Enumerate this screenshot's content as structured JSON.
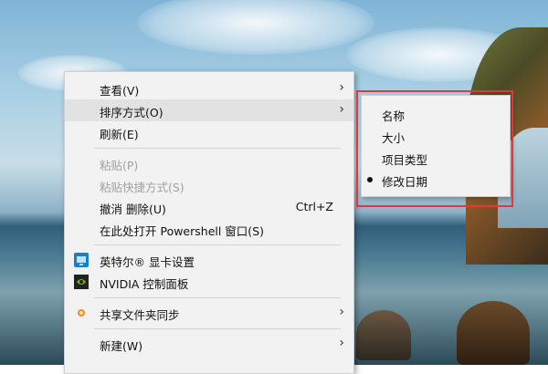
{
  "context_menu": {
    "items": [
      {
        "label": "查看(V)",
        "submenu": true,
        "enabled": true
      },
      {
        "label": "排序方式(O)",
        "submenu": true,
        "enabled": true,
        "highlighted": true
      },
      {
        "label": "刷新(E)",
        "submenu": false,
        "enabled": true
      },
      {
        "label": "粘贴(P)",
        "submenu": false,
        "enabled": false
      },
      {
        "label": "粘贴快捷方式(S)",
        "submenu": false,
        "enabled": false
      },
      {
        "label": "撤消 删除(U)",
        "shortcut": "Ctrl+Z",
        "submenu": false,
        "enabled": true
      },
      {
        "label": "在此处打开 Powershell 窗口(S)",
        "submenu": false,
        "enabled": true
      },
      {
        "label": "英特尔® 显卡设置",
        "icon": "intel-graphics-icon",
        "submenu": false,
        "enabled": true
      },
      {
        "label": "NVIDIA 控制面板",
        "icon": "nvidia-icon",
        "submenu": false,
        "enabled": true
      },
      {
        "label": "共享文件夹同步",
        "icon": "sync-share-icon",
        "submenu": true,
        "enabled": true
      },
      {
        "label": "新建(W)",
        "submenu": true,
        "enabled": true
      }
    ]
  },
  "sort_submenu": {
    "items": [
      {
        "label": "名称",
        "selected": false
      },
      {
        "label": "大小",
        "selected": false
      },
      {
        "label": "项目类型",
        "selected": false
      },
      {
        "label": "修改日期",
        "selected": true
      }
    ]
  },
  "colors": {
    "highlight_border": "#e0393c",
    "menu_bg": "#f2f2f2",
    "disabled_text": "#a0a0a0"
  }
}
